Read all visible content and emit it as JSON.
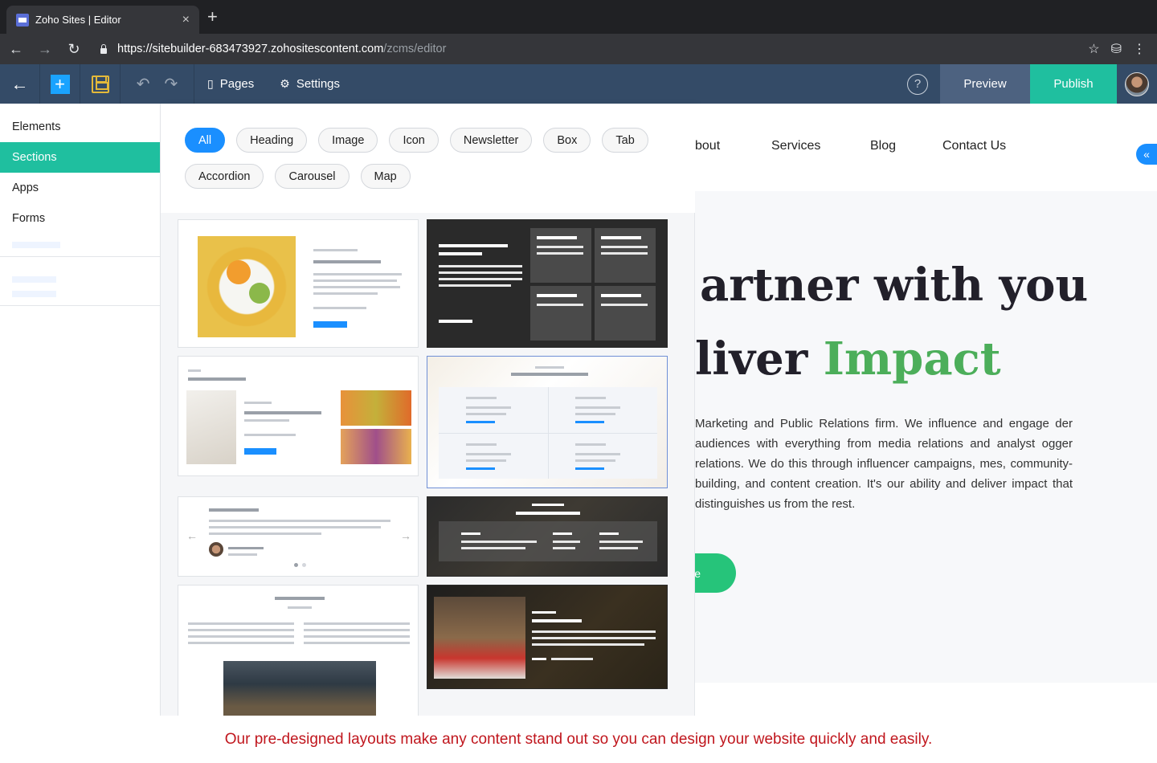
{
  "browser": {
    "tab_title": "Zoho Sites | Editor",
    "url_host": "https://sitebuilder-683473927.zohositescontent.com",
    "url_path": "/zcms/editor"
  },
  "toolbar": {
    "pages_label": "Pages",
    "settings_label": "Settings",
    "help_label": "?",
    "preview_label": "Preview",
    "publish_label": "Publish"
  },
  "sidebar": {
    "items": [
      {
        "label": "Elements"
      },
      {
        "label": "Sections"
      },
      {
        "label": "Apps"
      },
      {
        "label": "Forms"
      }
    ],
    "active": "Sections"
  },
  "filters": {
    "chips": [
      "All",
      "Heading",
      "Image",
      "Icon",
      "Newsletter",
      "Box",
      "Tab",
      "Accordion",
      "Carousel",
      "Map"
    ],
    "active": "All"
  },
  "website": {
    "nav": [
      "bout",
      "Services",
      "Blog",
      "Contact Us"
    ],
    "headline_line1": "artner with you",
    "headline_line2_a": "liver ",
    "headline_line2_b": "Impact",
    "paragraph": "Marketing and Public Relations firm. We influence and engage der audiences with everything from media relations and analyst ogger relations. We do this through influencer campaigns, mes, community-building, and content creation. It's our ability and deliver impact that distinguishes us from the rest.",
    "button_label": "e",
    "colors": {
      "accent_green": "#4cae5a",
      "button_green": "#26c47a"
    }
  },
  "caption": "Our pre-designed layouts make any content stand out so you can design your website quickly and easily.",
  "colors": {
    "toolbar": "#344b67",
    "publish": "#1fbf9f",
    "active_sidebar": "#1fbf9f",
    "active_chip": "#1a8fff",
    "caption_text": "#c0161d"
  }
}
